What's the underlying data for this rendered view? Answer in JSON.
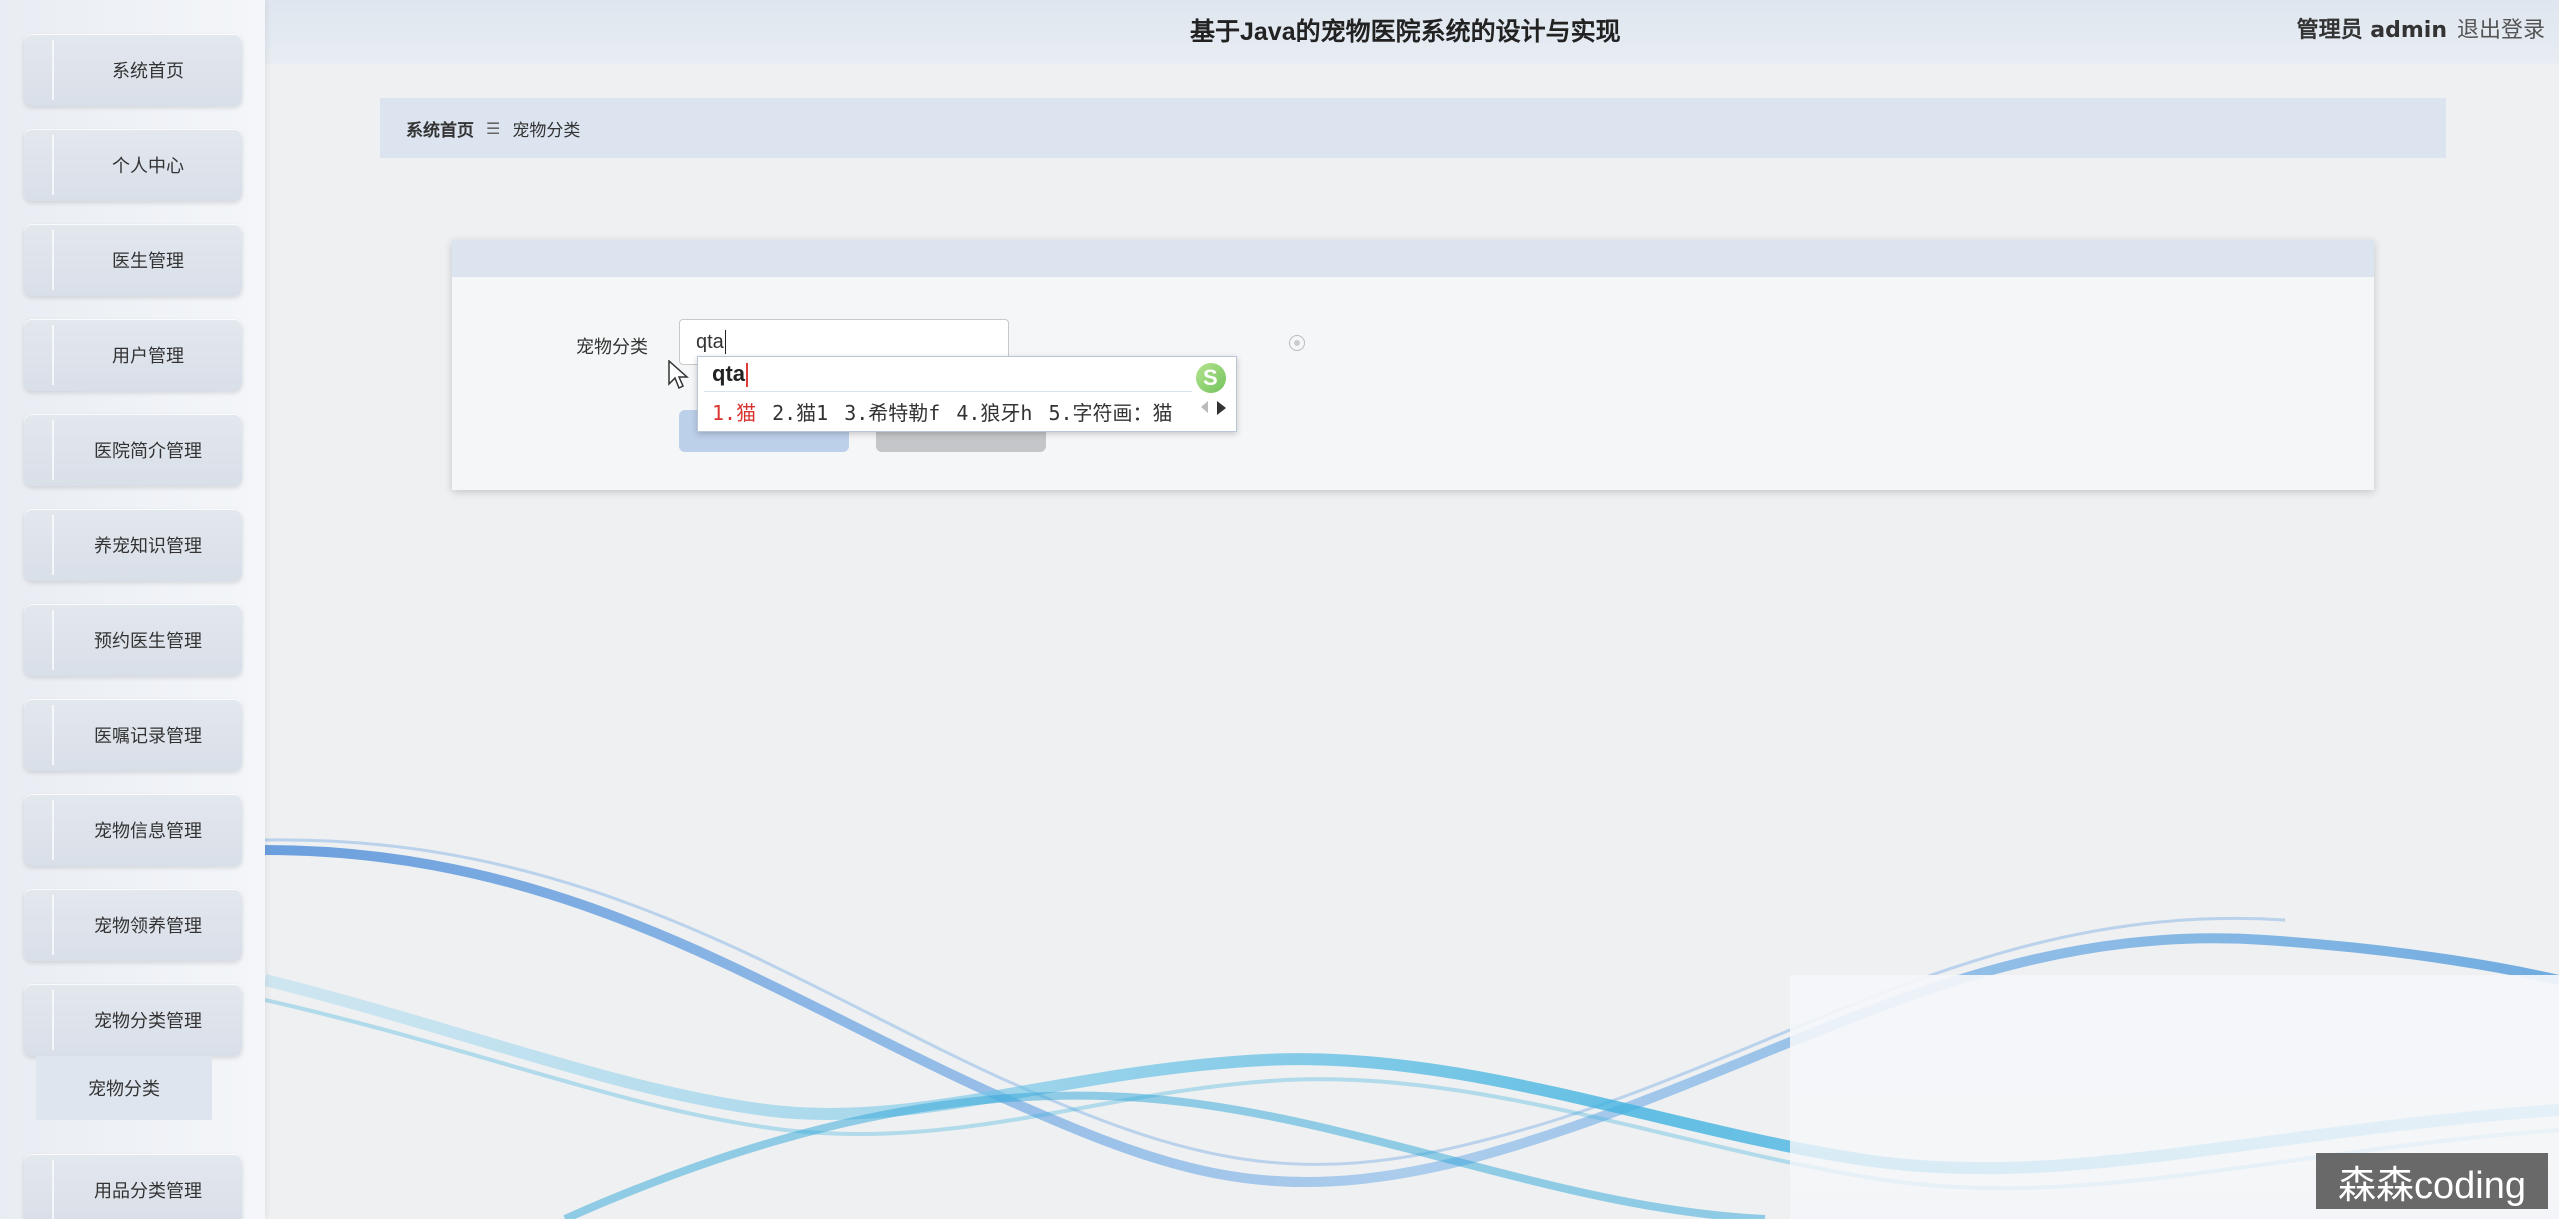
{
  "header": {
    "title": "基于Java的宠物医院系统的设计与实现",
    "user_label": "管理员 admin",
    "logout_label": "退出登录"
  },
  "sidebar": {
    "items": [
      {
        "label": "系统首页"
      },
      {
        "label": "个人中心"
      },
      {
        "label": "医生管理"
      },
      {
        "label": "用户管理"
      },
      {
        "label": "医院简介管理"
      },
      {
        "label": "养宠知识管理"
      },
      {
        "label": "预约医生管理"
      },
      {
        "label": "医嘱记录管理"
      },
      {
        "label": "宠物信息管理"
      },
      {
        "label": "宠物领养管理"
      },
      {
        "label": "宠物分类管理"
      },
      {
        "label": "用品分类管理"
      }
    ],
    "sub_item": {
      "label": "宠物分类"
    }
  },
  "breadcrumb": {
    "home": "系统首页",
    "separator": "☰",
    "current": "宠物分类"
  },
  "form": {
    "field_label": "宠物分类",
    "input_value": "qta"
  },
  "ime": {
    "pinyin": "qta",
    "candidates": [
      "1.猫",
      "2.猫1",
      "3.希特勒f",
      "4.狼牙h",
      "5.字符画：猫"
    ]
  },
  "watermark": {
    "text": "森森coding"
  },
  "colors": {
    "accent_blue": "#bcd0ea",
    "header_bg": "#dfe6ef",
    "ime_highlight": "#d9332f"
  }
}
